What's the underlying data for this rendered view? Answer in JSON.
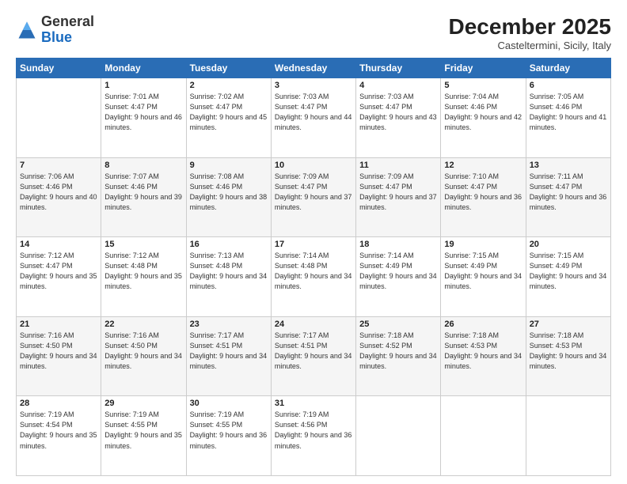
{
  "header": {
    "logo_general": "General",
    "logo_blue": "Blue",
    "month_title": "December 2025",
    "location": "Casteltermini, Sicily, Italy"
  },
  "weekdays": [
    "Sunday",
    "Monday",
    "Tuesday",
    "Wednesday",
    "Thursday",
    "Friday",
    "Saturday"
  ],
  "weeks": [
    [
      {
        "day": "",
        "sunrise": "",
        "sunset": "",
        "daylight": ""
      },
      {
        "day": "1",
        "sunrise": "Sunrise: 7:01 AM",
        "sunset": "Sunset: 4:47 PM",
        "daylight": "Daylight: 9 hours and 46 minutes."
      },
      {
        "day": "2",
        "sunrise": "Sunrise: 7:02 AM",
        "sunset": "Sunset: 4:47 PM",
        "daylight": "Daylight: 9 hours and 45 minutes."
      },
      {
        "day": "3",
        "sunrise": "Sunrise: 7:03 AM",
        "sunset": "Sunset: 4:47 PM",
        "daylight": "Daylight: 9 hours and 44 minutes."
      },
      {
        "day": "4",
        "sunrise": "Sunrise: 7:03 AM",
        "sunset": "Sunset: 4:47 PM",
        "daylight": "Daylight: 9 hours and 43 minutes."
      },
      {
        "day": "5",
        "sunrise": "Sunrise: 7:04 AM",
        "sunset": "Sunset: 4:46 PM",
        "daylight": "Daylight: 9 hours and 42 minutes."
      },
      {
        "day": "6",
        "sunrise": "Sunrise: 7:05 AM",
        "sunset": "Sunset: 4:46 PM",
        "daylight": "Daylight: 9 hours and 41 minutes."
      }
    ],
    [
      {
        "day": "7",
        "sunrise": "Sunrise: 7:06 AM",
        "sunset": "Sunset: 4:46 PM",
        "daylight": "Daylight: 9 hours and 40 minutes."
      },
      {
        "day": "8",
        "sunrise": "Sunrise: 7:07 AM",
        "sunset": "Sunset: 4:46 PM",
        "daylight": "Daylight: 9 hours and 39 minutes."
      },
      {
        "day": "9",
        "sunrise": "Sunrise: 7:08 AM",
        "sunset": "Sunset: 4:46 PM",
        "daylight": "Daylight: 9 hours and 38 minutes."
      },
      {
        "day": "10",
        "sunrise": "Sunrise: 7:09 AM",
        "sunset": "Sunset: 4:47 PM",
        "daylight": "Daylight: 9 hours and 37 minutes."
      },
      {
        "day": "11",
        "sunrise": "Sunrise: 7:09 AM",
        "sunset": "Sunset: 4:47 PM",
        "daylight": "Daylight: 9 hours and 37 minutes."
      },
      {
        "day": "12",
        "sunrise": "Sunrise: 7:10 AM",
        "sunset": "Sunset: 4:47 PM",
        "daylight": "Daylight: 9 hours and 36 minutes."
      },
      {
        "day": "13",
        "sunrise": "Sunrise: 7:11 AM",
        "sunset": "Sunset: 4:47 PM",
        "daylight": "Daylight: 9 hours and 36 minutes."
      }
    ],
    [
      {
        "day": "14",
        "sunrise": "Sunrise: 7:12 AM",
        "sunset": "Sunset: 4:47 PM",
        "daylight": "Daylight: 9 hours and 35 minutes."
      },
      {
        "day": "15",
        "sunrise": "Sunrise: 7:12 AM",
        "sunset": "Sunset: 4:48 PM",
        "daylight": "Daylight: 9 hours and 35 minutes."
      },
      {
        "day": "16",
        "sunrise": "Sunrise: 7:13 AM",
        "sunset": "Sunset: 4:48 PM",
        "daylight": "Daylight: 9 hours and 34 minutes."
      },
      {
        "day": "17",
        "sunrise": "Sunrise: 7:14 AM",
        "sunset": "Sunset: 4:48 PM",
        "daylight": "Daylight: 9 hours and 34 minutes."
      },
      {
        "day": "18",
        "sunrise": "Sunrise: 7:14 AM",
        "sunset": "Sunset: 4:49 PM",
        "daylight": "Daylight: 9 hours and 34 minutes."
      },
      {
        "day": "19",
        "sunrise": "Sunrise: 7:15 AM",
        "sunset": "Sunset: 4:49 PM",
        "daylight": "Daylight: 9 hours and 34 minutes."
      },
      {
        "day": "20",
        "sunrise": "Sunrise: 7:15 AM",
        "sunset": "Sunset: 4:49 PM",
        "daylight": "Daylight: 9 hours and 34 minutes."
      }
    ],
    [
      {
        "day": "21",
        "sunrise": "Sunrise: 7:16 AM",
        "sunset": "Sunset: 4:50 PM",
        "daylight": "Daylight: 9 hours and 34 minutes."
      },
      {
        "day": "22",
        "sunrise": "Sunrise: 7:16 AM",
        "sunset": "Sunset: 4:50 PM",
        "daylight": "Daylight: 9 hours and 34 minutes."
      },
      {
        "day": "23",
        "sunrise": "Sunrise: 7:17 AM",
        "sunset": "Sunset: 4:51 PM",
        "daylight": "Daylight: 9 hours and 34 minutes."
      },
      {
        "day": "24",
        "sunrise": "Sunrise: 7:17 AM",
        "sunset": "Sunset: 4:51 PM",
        "daylight": "Daylight: 9 hours and 34 minutes."
      },
      {
        "day": "25",
        "sunrise": "Sunrise: 7:18 AM",
        "sunset": "Sunset: 4:52 PM",
        "daylight": "Daylight: 9 hours and 34 minutes."
      },
      {
        "day": "26",
        "sunrise": "Sunrise: 7:18 AM",
        "sunset": "Sunset: 4:53 PM",
        "daylight": "Daylight: 9 hours and 34 minutes."
      },
      {
        "day": "27",
        "sunrise": "Sunrise: 7:18 AM",
        "sunset": "Sunset: 4:53 PM",
        "daylight": "Daylight: 9 hours and 34 minutes."
      }
    ],
    [
      {
        "day": "28",
        "sunrise": "Sunrise: 7:19 AM",
        "sunset": "Sunset: 4:54 PM",
        "daylight": "Daylight: 9 hours and 35 minutes."
      },
      {
        "day": "29",
        "sunrise": "Sunrise: 7:19 AM",
        "sunset": "Sunset: 4:55 PM",
        "daylight": "Daylight: 9 hours and 35 minutes."
      },
      {
        "day": "30",
        "sunrise": "Sunrise: 7:19 AM",
        "sunset": "Sunset: 4:55 PM",
        "daylight": "Daylight: 9 hours and 36 minutes."
      },
      {
        "day": "31",
        "sunrise": "Sunrise: 7:19 AM",
        "sunset": "Sunset: 4:56 PM",
        "daylight": "Daylight: 9 hours and 36 minutes."
      },
      {
        "day": "",
        "sunrise": "",
        "sunset": "",
        "daylight": ""
      },
      {
        "day": "",
        "sunrise": "",
        "sunset": "",
        "daylight": ""
      },
      {
        "day": "",
        "sunrise": "",
        "sunset": "",
        "daylight": ""
      }
    ]
  ]
}
